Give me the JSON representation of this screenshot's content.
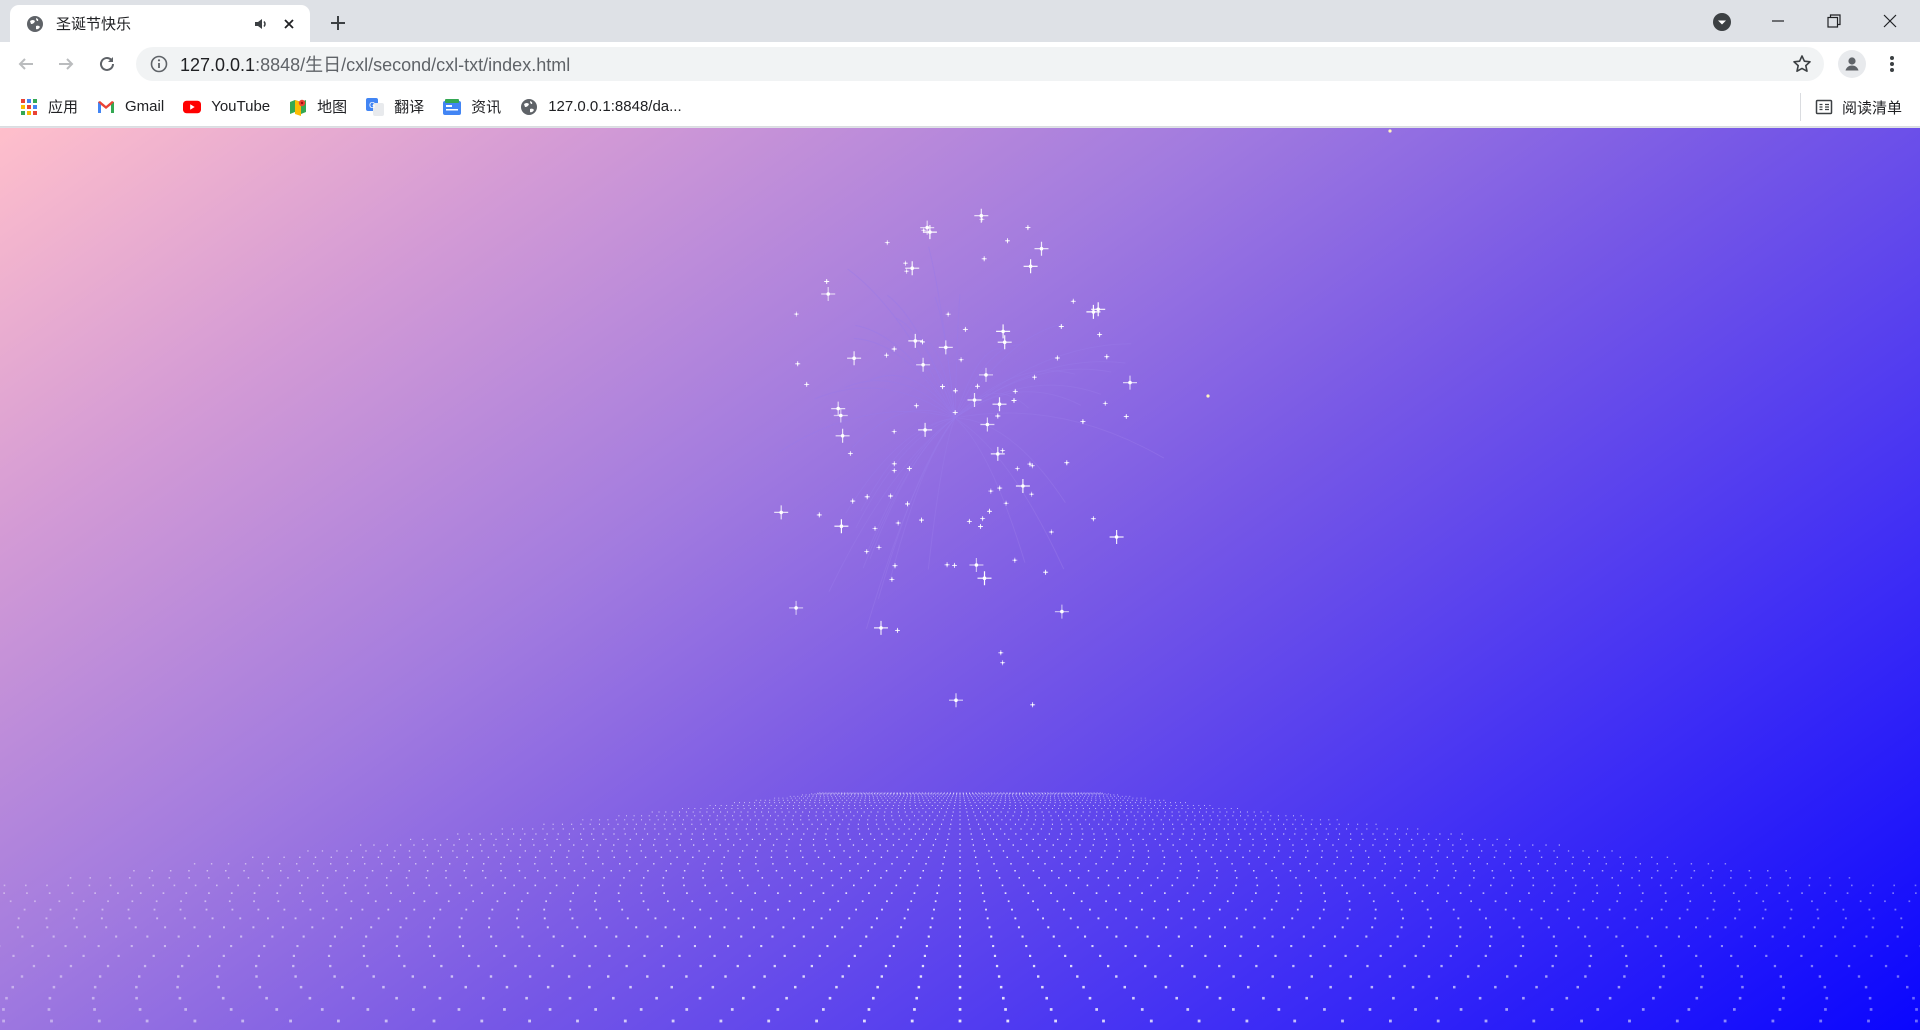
{
  "tab": {
    "title": "圣诞节快乐"
  },
  "omnibox": {
    "url_host": "127.0.0.1",
    "url_rest": ":8848/生日/cxl/second/cxl-txt/index.html"
  },
  "bookmarks": [
    {
      "label": "应用",
      "icon": "apps-grid-icon"
    },
    {
      "label": "Gmail",
      "icon": "gmail-icon"
    },
    {
      "label": "YouTube",
      "icon": "youtube-icon"
    },
    {
      "label": "地图",
      "icon": "maps-icon"
    },
    {
      "label": "翻译",
      "icon": "translate-icon"
    },
    {
      "label": "资讯",
      "icon": "news-icon"
    },
    {
      "label": "127.0.0.1:8848/da...",
      "icon": "globe-icon"
    }
  ],
  "reading_list": {
    "label": "阅读清单",
    "icon": "reading-list-icon"
  },
  "colors": {
    "bg_top_left": "#ffbfcb",
    "bg_bottom_right": "#0a06fe",
    "particles": "#ffffff"
  }
}
